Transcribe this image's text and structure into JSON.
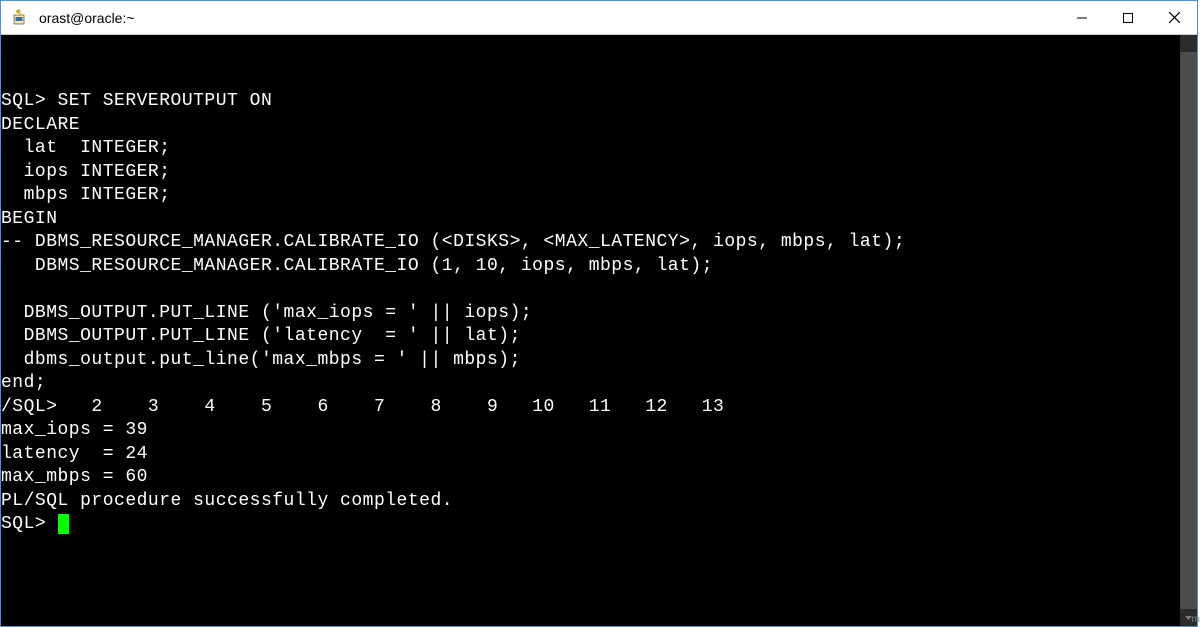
{
  "titlebar": {
    "title": "orast@oracle:~"
  },
  "terminal": {
    "lines": [
      "SQL> SET SERVEROUTPUT ON",
      "DECLARE",
      "  lat  INTEGER;",
      "  iops INTEGER;",
      "  mbps INTEGER;",
      "BEGIN",
      "-- DBMS_RESOURCE_MANAGER.CALIBRATE_IO (<DISKS>, <MAX_LATENCY>, iops, mbps, lat);",
      "   DBMS_RESOURCE_MANAGER.CALIBRATE_IO (1, 10, iops, mbps, lat);",
      " ",
      "  DBMS_OUTPUT.PUT_LINE ('max_iops = ' || iops);",
      "  DBMS_OUTPUT.PUT_LINE ('latency  = ' || lat);",
      "  dbms_output.put_line('max_mbps = ' || mbps);",
      "end;",
      "/SQL>   2    3    4    5    6    7    8    9   10   11   12   13",
      "max_iops = 39",
      "latency  = 24",
      "max_mbps = 60",
      "",
      "PL/SQL procedure successfully completed.",
      "",
      "SQL> "
    ],
    "prompt": "SQL> "
  },
  "watermark": "m"
}
